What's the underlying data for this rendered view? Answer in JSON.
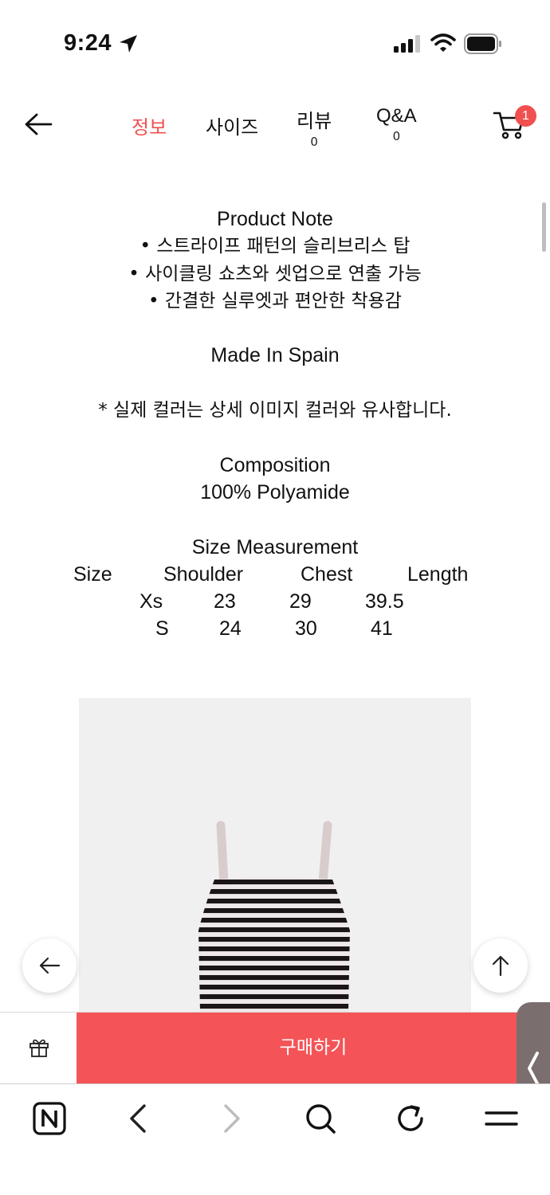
{
  "status_bar": {
    "time": "9:24",
    "icons": [
      "location-arrow-icon",
      "cellular-signal-icon",
      "wifi-icon",
      "battery-icon"
    ]
  },
  "nav": {
    "tabs": [
      {
        "label": "정보",
        "count": null,
        "active": true
      },
      {
        "label": "사이즈",
        "count": null,
        "active": false
      },
      {
        "label": "리뷰",
        "count": "0",
        "active": false
      },
      {
        "label": "Q&A",
        "count": "0",
        "active": false
      }
    ],
    "cart_badge": "1",
    "accent_color": "#f0504f"
  },
  "content": {
    "product_note_title": "Product Note",
    "notes": [
      "• 스트라이프 패턴의 슬리브리스 탑",
      "• 사이클링 쇼츠와 셋업으로 연출 가능",
      "• 간결한 실루엣과 편안한 착용감"
    ],
    "origin": "Made In Spain",
    "color_notice": "* 실제 컬러는 상세 이미지 컬러와 유사합니다.",
    "composition_title": "Composition",
    "composition": "100% Polyamide",
    "size_title": "Size Measurement",
    "size_headers": [
      "Size",
      "Shoulder",
      "Chest",
      "Length"
    ],
    "size_rows": [
      [
        "Xs",
        "23",
        "29",
        "39.5"
      ],
      [
        "S",
        "24",
        "30",
        "41"
      ]
    ]
  },
  "buy_bar": {
    "buy_label": "구매하기",
    "buy_color": "#f45457"
  },
  "toolbar": {
    "icons": [
      "naver-n-icon",
      "back-chevron-icon",
      "forward-chevron-icon",
      "search-icon",
      "reload-icon",
      "menu-icon"
    ]
  }
}
